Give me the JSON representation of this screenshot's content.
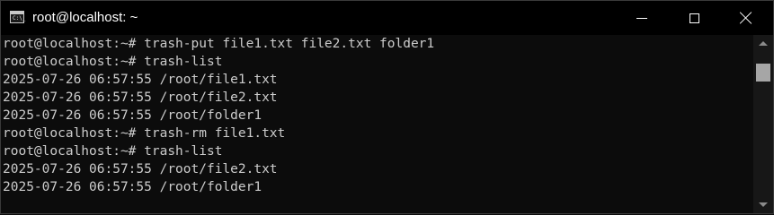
{
  "window": {
    "title": "root@localhost: ~",
    "app_icon": "terminal-icon",
    "app_icon_text": "C:\\_",
    "controls": {
      "minimize": "minimize-icon",
      "maximize": "maximize-icon",
      "close": "close-icon"
    }
  },
  "terminal": {
    "lines": [
      "root@localhost:~# trash-put file1.txt file2.txt folder1",
      "root@localhost:~# trash-list",
      "2025-07-26 06:57:55 /root/file1.txt",
      "2025-07-26 06:57:55 /root/file2.txt",
      "2025-07-26 06:57:55 /root/folder1",
      "root@localhost:~# trash-rm file1.txt",
      "root@localhost:~# trash-list",
      "2025-07-26 06:57:55 /root/file2.txt",
      "2025-07-26 06:57:55 /root/folder1"
    ]
  },
  "colors": {
    "background": "#0c0c0c",
    "foreground": "#cccccc",
    "titlebar": "#000000"
  }
}
